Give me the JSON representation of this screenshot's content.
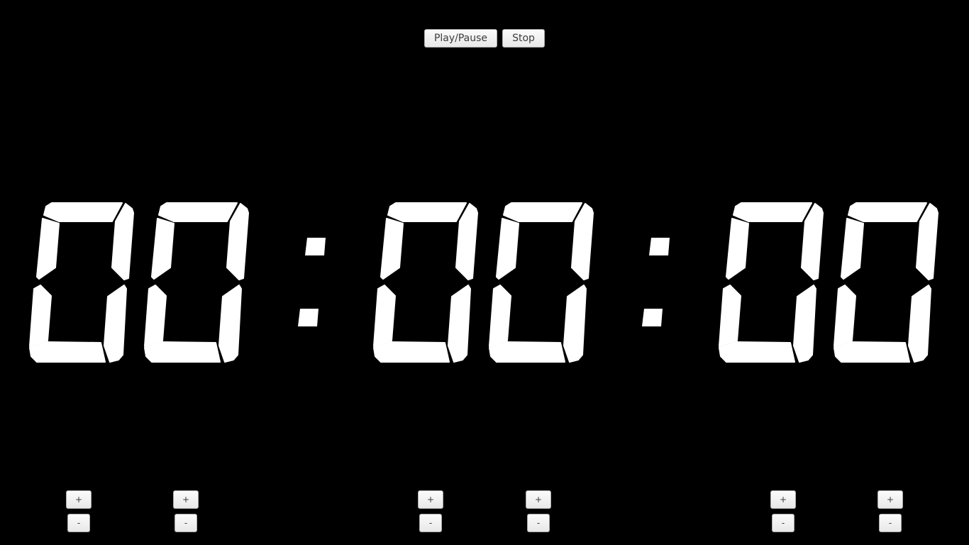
{
  "controls": {
    "play_pause_label": "Play/Pause",
    "stop_label": "Stop"
  },
  "display": {
    "hours": "00",
    "minutes": "00",
    "seconds": "00",
    "separator": ":",
    "digit_color": "#ffffff",
    "background": "#000000"
  },
  "adjusters": [
    {
      "unit": "hours-tens",
      "plus": "+",
      "minus": "-"
    },
    {
      "unit": "hours-ones",
      "plus": "+",
      "minus": "-"
    },
    {
      "unit": "minutes-tens",
      "plus": "+",
      "minus": "-"
    },
    {
      "unit": "minutes-ones",
      "plus": "+",
      "minus": "-"
    },
    {
      "unit": "seconds-tens",
      "plus": "+",
      "minus": "-"
    },
    {
      "unit": "seconds-ones",
      "plus": "+",
      "minus": "-"
    }
  ]
}
